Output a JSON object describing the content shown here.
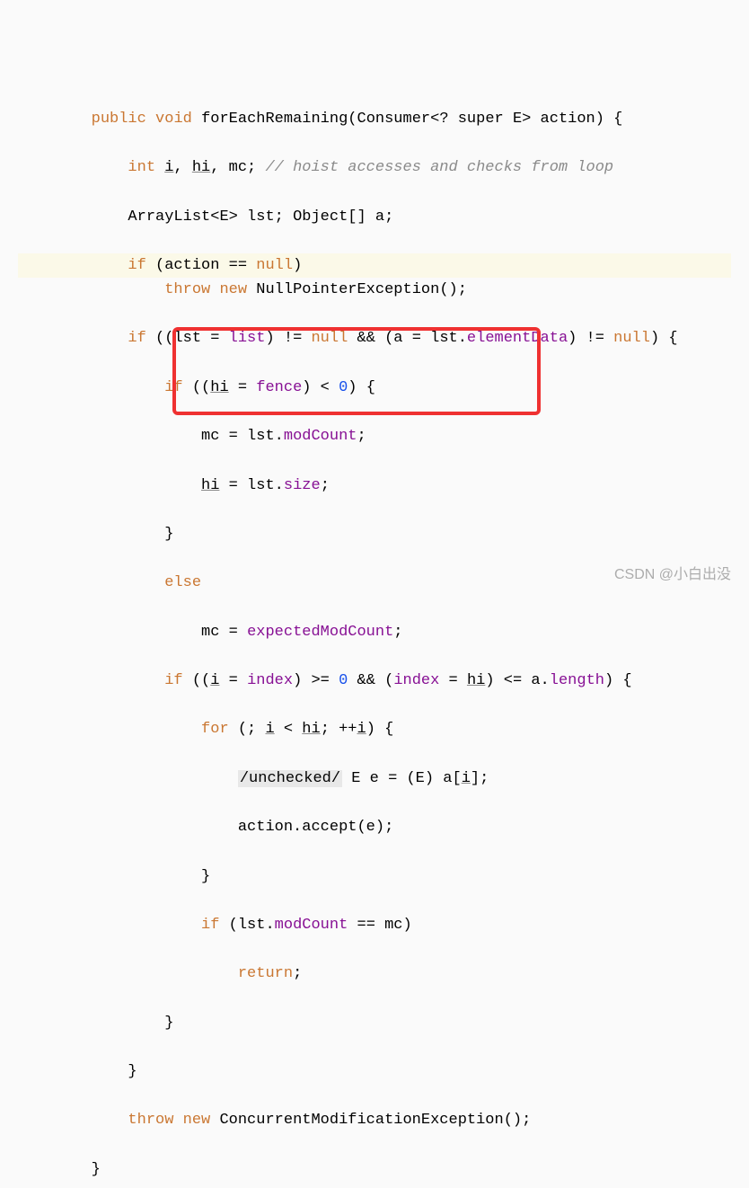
{
  "code": {
    "l1": {
      "kw1": "public",
      "kw2": "void",
      "method": "forEachRemaining",
      "paren_open": "(",
      "type": "Consumer",
      "generic": "<? super E>",
      "param": " action",
      "paren_close": ")",
      "brace": " {"
    },
    "l2": {
      "kw": "int",
      "vars": " i, hi, mc;",
      "comment": " // hoist accesses and checks from loop"
    },
    "l3": {
      "type1": "ArrayList",
      "generic": "<E>",
      "var1": " lst;",
      "type2": " Object[]",
      "var2": " a;"
    },
    "l4": {
      "kw": "if",
      "cond": " (action == ",
      "kw2": "null",
      "close": ")"
    },
    "l5": {
      "kw1": "throw",
      "kw2": "new",
      "type": " NullPointerException",
      "call": "();"
    },
    "l6": {
      "kw": "if",
      "p1": " ((lst = ",
      "field": "list",
      "p2": ") != ",
      "kw2": "null",
      "p3": " && (a = lst.",
      "field2": "elementData",
      "p4": ") != ",
      "kw3": "null",
      "close": ") {"
    },
    "l7": {
      "kw": "if",
      "p1": " ((",
      "var": "hi",
      "p2": " = ",
      "field": "fence",
      "p3": ") < ",
      "num": "0",
      "close": ") {"
    },
    "l8": {
      "p1": "mc = lst.",
      "field": "modCount",
      "p2": ";"
    },
    "l9": {
      "var": "hi",
      "p1": " = lst.",
      "field": "size",
      "p2": ";"
    },
    "l10": {
      "brace": "}"
    },
    "l11": {
      "kw": "else"
    },
    "l12": {
      "p1": "mc = ",
      "field": "expectedModCount",
      "p2": ";"
    },
    "l13": {
      "kw": "if",
      "p1": " ((",
      "var": "i",
      "p2": " = ",
      "field": "index",
      "p3": ") >= ",
      "num1": "0",
      "p4": " && (",
      "field2": "index",
      "p5": " = ",
      "var2": "hi",
      "p6": ") <= a.",
      "field3": "length",
      "close": ") {"
    },
    "l14": {
      "kw": "for",
      "p1": " (; ",
      "var1": "i",
      "p2": " < ",
      "var2": "hi",
      "p3": "; ++",
      "var3": "i",
      "close": ") {"
    },
    "l15": {
      "anno": "/unchecked/",
      "p1": " E e = (E) a[",
      "var": "i",
      "p2": "];"
    },
    "l16": {
      "p1": "action.",
      "call": "accept",
      "p2": "(e);"
    },
    "l17": {
      "brace": "}"
    },
    "l18": {
      "kw": "if",
      "p1": " (lst.",
      "field": "modCount",
      "p2": " == mc)"
    },
    "l19": {
      "kw": "return",
      "p": ";"
    },
    "l20": {
      "brace": "}"
    },
    "l21": {
      "brace": "}"
    },
    "l22": {
      "kw1": "throw",
      "kw2": "new",
      "type": " ConcurrentModificationException",
      "call": "();"
    },
    "l23": {
      "brace": "}"
    }
  },
  "watermark": "CSDN @小白出没"
}
